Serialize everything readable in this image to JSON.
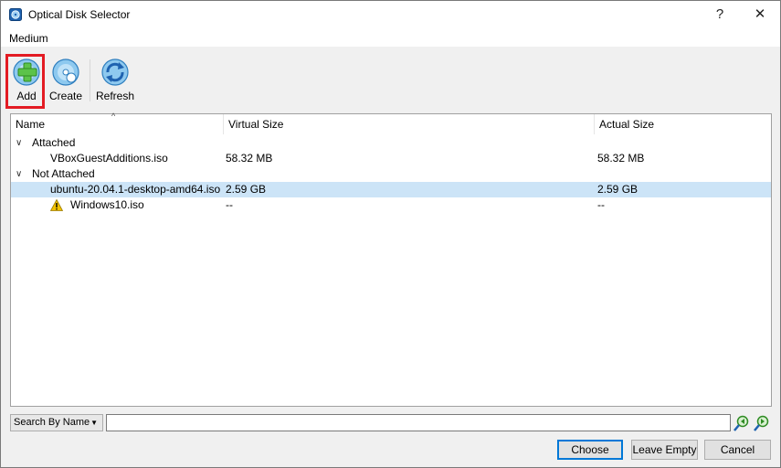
{
  "window": {
    "title": "Optical Disk Selector",
    "help_glyph": "?",
    "close_glyph": "✕",
    "icon": "virtualbox-disk-icon"
  },
  "menu": {
    "medium": "Medium"
  },
  "toolbar": {
    "add": {
      "label": "Add",
      "icon": "add-disk-icon"
    },
    "create": {
      "label": "Create",
      "icon": "create-disk-icon"
    },
    "refresh": {
      "label": "Refresh",
      "icon": "refresh-icon"
    }
  },
  "table": {
    "columns": {
      "name": "Name",
      "virtual_size": "Virtual Size",
      "actual_size": "Actual Size"
    },
    "groups": [
      {
        "label": "Attached",
        "items": [
          {
            "name": "VBoxGuestAdditions.iso",
            "virtual_size": "58.32 MB",
            "actual_size": "58.32 MB"
          }
        ]
      },
      {
        "label": "Not Attached",
        "items": [
          {
            "name": "ubuntu-20.04.1-desktop-amd64.iso",
            "virtual_size": "2.59 GB",
            "actual_size": "2.59 GB",
            "selected": true
          },
          {
            "name": "Windows10.iso",
            "virtual_size": "--",
            "actual_size": "--",
            "warning": true
          }
        ]
      }
    ]
  },
  "search": {
    "mode": "Search By Name",
    "value": "",
    "prev_icon": "search-backward-icon",
    "next_icon": "search-forward-icon"
  },
  "buttons": {
    "choose": "Choose",
    "leave_empty": "Leave Empty",
    "cancel": "Cancel"
  },
  "colors": {
    "selection": "#cce4f7",
    "highlight_box": "#e31b23",
    "default_button_border": "#0078d7",
    "warning": "#f2c200"
  }
}
